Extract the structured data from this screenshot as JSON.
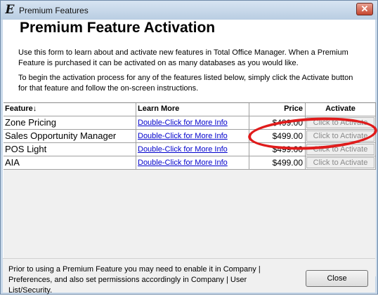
{
  "window": {
    "title": "Premium Features",
    "app_icon": "E",
    "close_glyph": "✕"
  },
  "heading": "Premium Feature Activation",
  "paragraphs": [
    "Use this form to learn about and activate new features in Total Office Manager. When a Premium Feature is purchased it can be activated on as many databases as you would like.",
    "To begin the activation process for any of the features listed below, simply click the Activate button for that feature and follow the on-screen instructions."
  ],
  "table": {
    "headers": {
      "feature": "Feature",
      "sort_arrow": "↓",
      "learn_more": "Learn More",
      "price": "Price",
      "activate": "Activate"
    },
    "rows": [
      {
        "feature": "Zone Pricing",
        "learn_more": "Double-Click for More Info",
        "price": "$499.00",
        "activate": "Click to Activate"
      },
      {
        "feature": "Sales Opportunity Manager",
        "learn_more": "Double-Click for More Info",
        "price": "$499.00",
        "activate": "Click to Activate"
      },
      {
        "feature": "POS Light",
        "learn_more": "Double-Click for More Info",
        "price": "$499.00",
        "activate": "Click to Activate"
      },
      {
        "feature": "AIA",
        "learn_more": "Double-Click for More Info",
        "price": "$499.00",
        "activate": "Click to Activate"
      }
    ]
  },
  "footer": {
    "note": "Prior to using a Premium Feature you may need to enable it in Company | Preferences, and also set permissions accordingly in Company | User List/Security.",
    "close_label": "Close"
  },
  "colors": {
    "annotation": "#e01b1b",
    "link": "#0000cc"
  }
}
